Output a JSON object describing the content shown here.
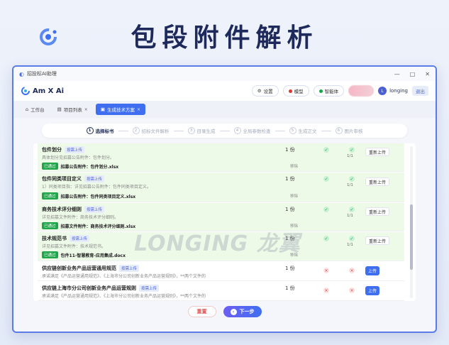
{
  "headline": "包段附件解析",
  "window": {
    "title": "招投标AI助理",
    "controls": [
      "—",
      "□",
      "✕"
    ]
  },
  "brand": {
    "name": "Am X Ai"
  },
  "appbar": {
    "settings_label": "设置",
    "model_label": "模型",
    "agent_label": "智能体",
    "user_initial": "L",
    "user_name": "longing",
    "logout_label": "退出",
    "colors": {
      "model_dot": "#e0342f",
      "agent_dot": "#19a34a"
    }
  },
  "tabs": [
    {
      "label": "工作台"
    },
    {
      "label": "项目列表"
    },
    {
      "label": "生成技术方案"
    }
  ],
  "steps": [
    {
      "num": "1",
      "label": "选择标书"
    },
    {
      "num": "2",
      "label": "招标文件解析"
    },
    {
      "num": "3",
      "label": "目录生成"
    },
    {
      "num": "4",
      "label": "全局参数检查"
    },
    {
      "num": "5",
      "label": "生成正文"
    },
    {
      "num": "6",
      "label": "图片审核"
    }
  ],
  "rows": [
    {
      "title": "包件划分",
      "tag": "按需上传",
      "desc": "具体划分见招募公告附件：包件划分。",
      "status": "已通过",
      "file": "招募公告附件：包件划分.xlsx",
      "remove": "移除",
      "copies": "1 份",
      "fraction": "1/1",
      "action": "重新上传"
    },
    {
      "title": "包件同类项目定义",
      "tag": "按需上传",
      "desc": "1）同类项目指：详见招募公告附件：包件同类项目定义。",
      "status": "已通过",
      "file": "招募公告附件：包件同类项目定义.xlsx",
      "remove": "移除",
      "copies": "1 份",
      "fraction": "1/1",
      "action": "重新上传"
    },
    {
      "title": "商务技术评分细则",
      "tag": "按需上传",
      "desc": "详见招募文件附件：商务技术评分细则。",
      "status": "已通过",
      "file": "招募文件附件：商务技术评分细则.xlsx",
      "remove": "移除",
      "copies": "1 份",
      "fraction": "1/1",
      "action": "重新上传"
    },
    {
      "title": "技术规范书",
      "tag": "按需上传",
      "desc": "详见招募文件附件：技术规范书。",
      "status": "已通过",
      "file": "包件11-智慧教育-应用集成.docx",
      "remove": "移除",
      "copies": "1 份",
      "fraction": "1/1",
      "action": "重新上传"
    },
    {
      "title": "供应链创新业务产品运营通用规范",
      "tag": "按需上传",
      "desc": "承诺满足《产品运营通用规范》、《上海市分公司创新业务产品运营规则》，**两个文件的",
      "copies": "1 份",
      "action": "上传"
    },
    {
      "title": "供应链上海市分公司创新业务产品运营规则",
      "tag": "按需上传",
      "desc": "承诺满足《产品运营通用规范》、《上海市分公司创新业务产品运营规则》，**两个文件的",
      "copies": "1 份",
      "action": "上传"
    }
  ],
  "watermark": "LONGING 龙翼",
  "footer": {
    "reset_label": "重置",
    "next_label": "下一步"
  }
}
